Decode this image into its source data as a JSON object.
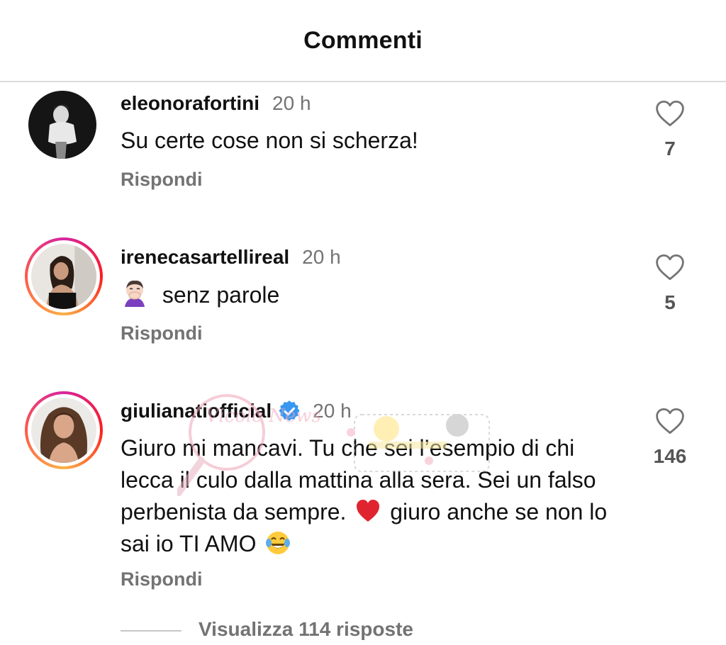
{
  "header": {
    "title": "Commenti"
  },
  "comments": [
    {
      "username": "eleonorafortini",
      "time": "20 h",
      "text": "Su certe cose non si scherza!",
      "reply": "Rispondi",
      "likes": "7",
      "avatar_icon": "avatar-photo",
      "story_ring": false,
      "verified": false
    },
    {
      "username": "irenecasartellireal",
      "time": "20 h",
      "emoji": "face-with-hand-over-mouth-emoji",
      "text": "senz parole",
      "reply": "Rispondi",
      "likes": "5",
      "avatar_icon": "avatar-photo",
      "story_ring": true,
      "verified": false
    },
    {
      "username": "giulianatiofficial",
      "time": "20 h",
      "text_part1": "Giuro mi mancavi. Tu che sei l’esempio di chi lecca il culo dalla mattina alla sera. Sei un falso perbenista da sempre.",
      "emoji1": "red-heart-emoji",
      "text_part2": "giuro anche se non lo sai io TI AMO",
      "emoji2": "face-with-tears-of-joy-emoji",
      "reply": "Rispondi",
      "likes": "146",
      "avatar_icon": "avatar-photo",
      "story_ring": true,
      "verified": true,
      "verified_color": "#3897f0"
    }
  ],
  "view_replies": {
    "label": "Visualizza 114 risposte"
  },
  "watermark": {
    "text": "Vicolo News"
  },
  "colors": {
    "primary_text": "#111111",
    "secondary_text": "#737373",
    "divider": "#dbdbdb",
    "story_ring": [
      "#d6249f",
      "#fd1d1d",
      "#fcb045"
    ]
  }
}
